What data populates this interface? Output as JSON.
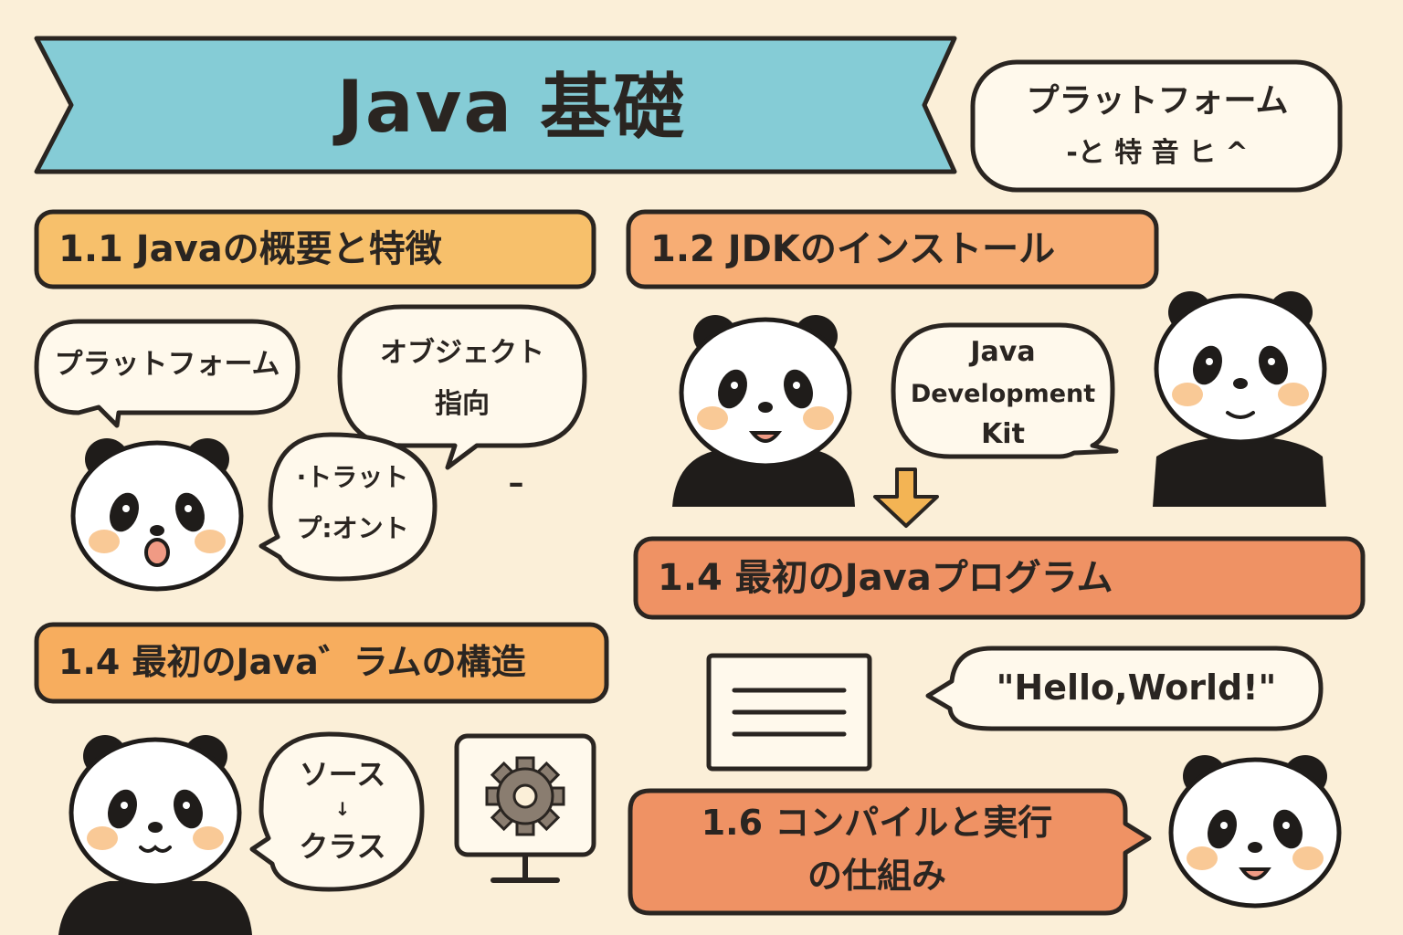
{
  "title": "Java 基礎",
  "subtitle_bubble": {
    "line1": "プラットフォーム",
    "line2": "-と 特 音 ヒ ^"
  },
  "sections": {
    "s1": "1.1 Javaの概要と特徴",
    "s2": "1.2 JDKのインストール",
    "s3": "1.4 最初のJavaプログラム",
    "s4": "1.4 最初のJava゛ラムの構造",
    "s5": {
      "line1": "1.6 コンパイルと実行",
      "line2": "の仕組み"
    }
  },
  "bubbles": {
    "platform": "プラットフォーム",
    "object": {
      "line1": "オブジェクト",
      "line2": "指向"
    },
    "trat": {
      "line1": "·トラット",
      "line2": "プ:オント"
    },
    "dash": "–",
    "jdk": {
      "line1": "Java",
      "line2": "Development",
      "line3": "Kit"
    },
    "hello": "\"Hello,World!\"",
    "source": {
      "line1": "ソース",
      "line2": "↓",
      "line3": "クラス"
    }
  },
  "colors": {
    "background": "#fbefd8",
    "banner": "#85ccd6",
    "section_yellow": "#f7c06b",
    "section_orange": "#f7ad74",
    "section_coral": "#ef9264",
    "outline": "#2a2521",
    "cheek": "#f9c996",
    "arrow": "#f3b454"
  },
  "icons": [
    "panda-icon",
    "gear-icon",
    "monitor-icon",
    "document-icon",
    "down-arrow-icon"
  ]
}
